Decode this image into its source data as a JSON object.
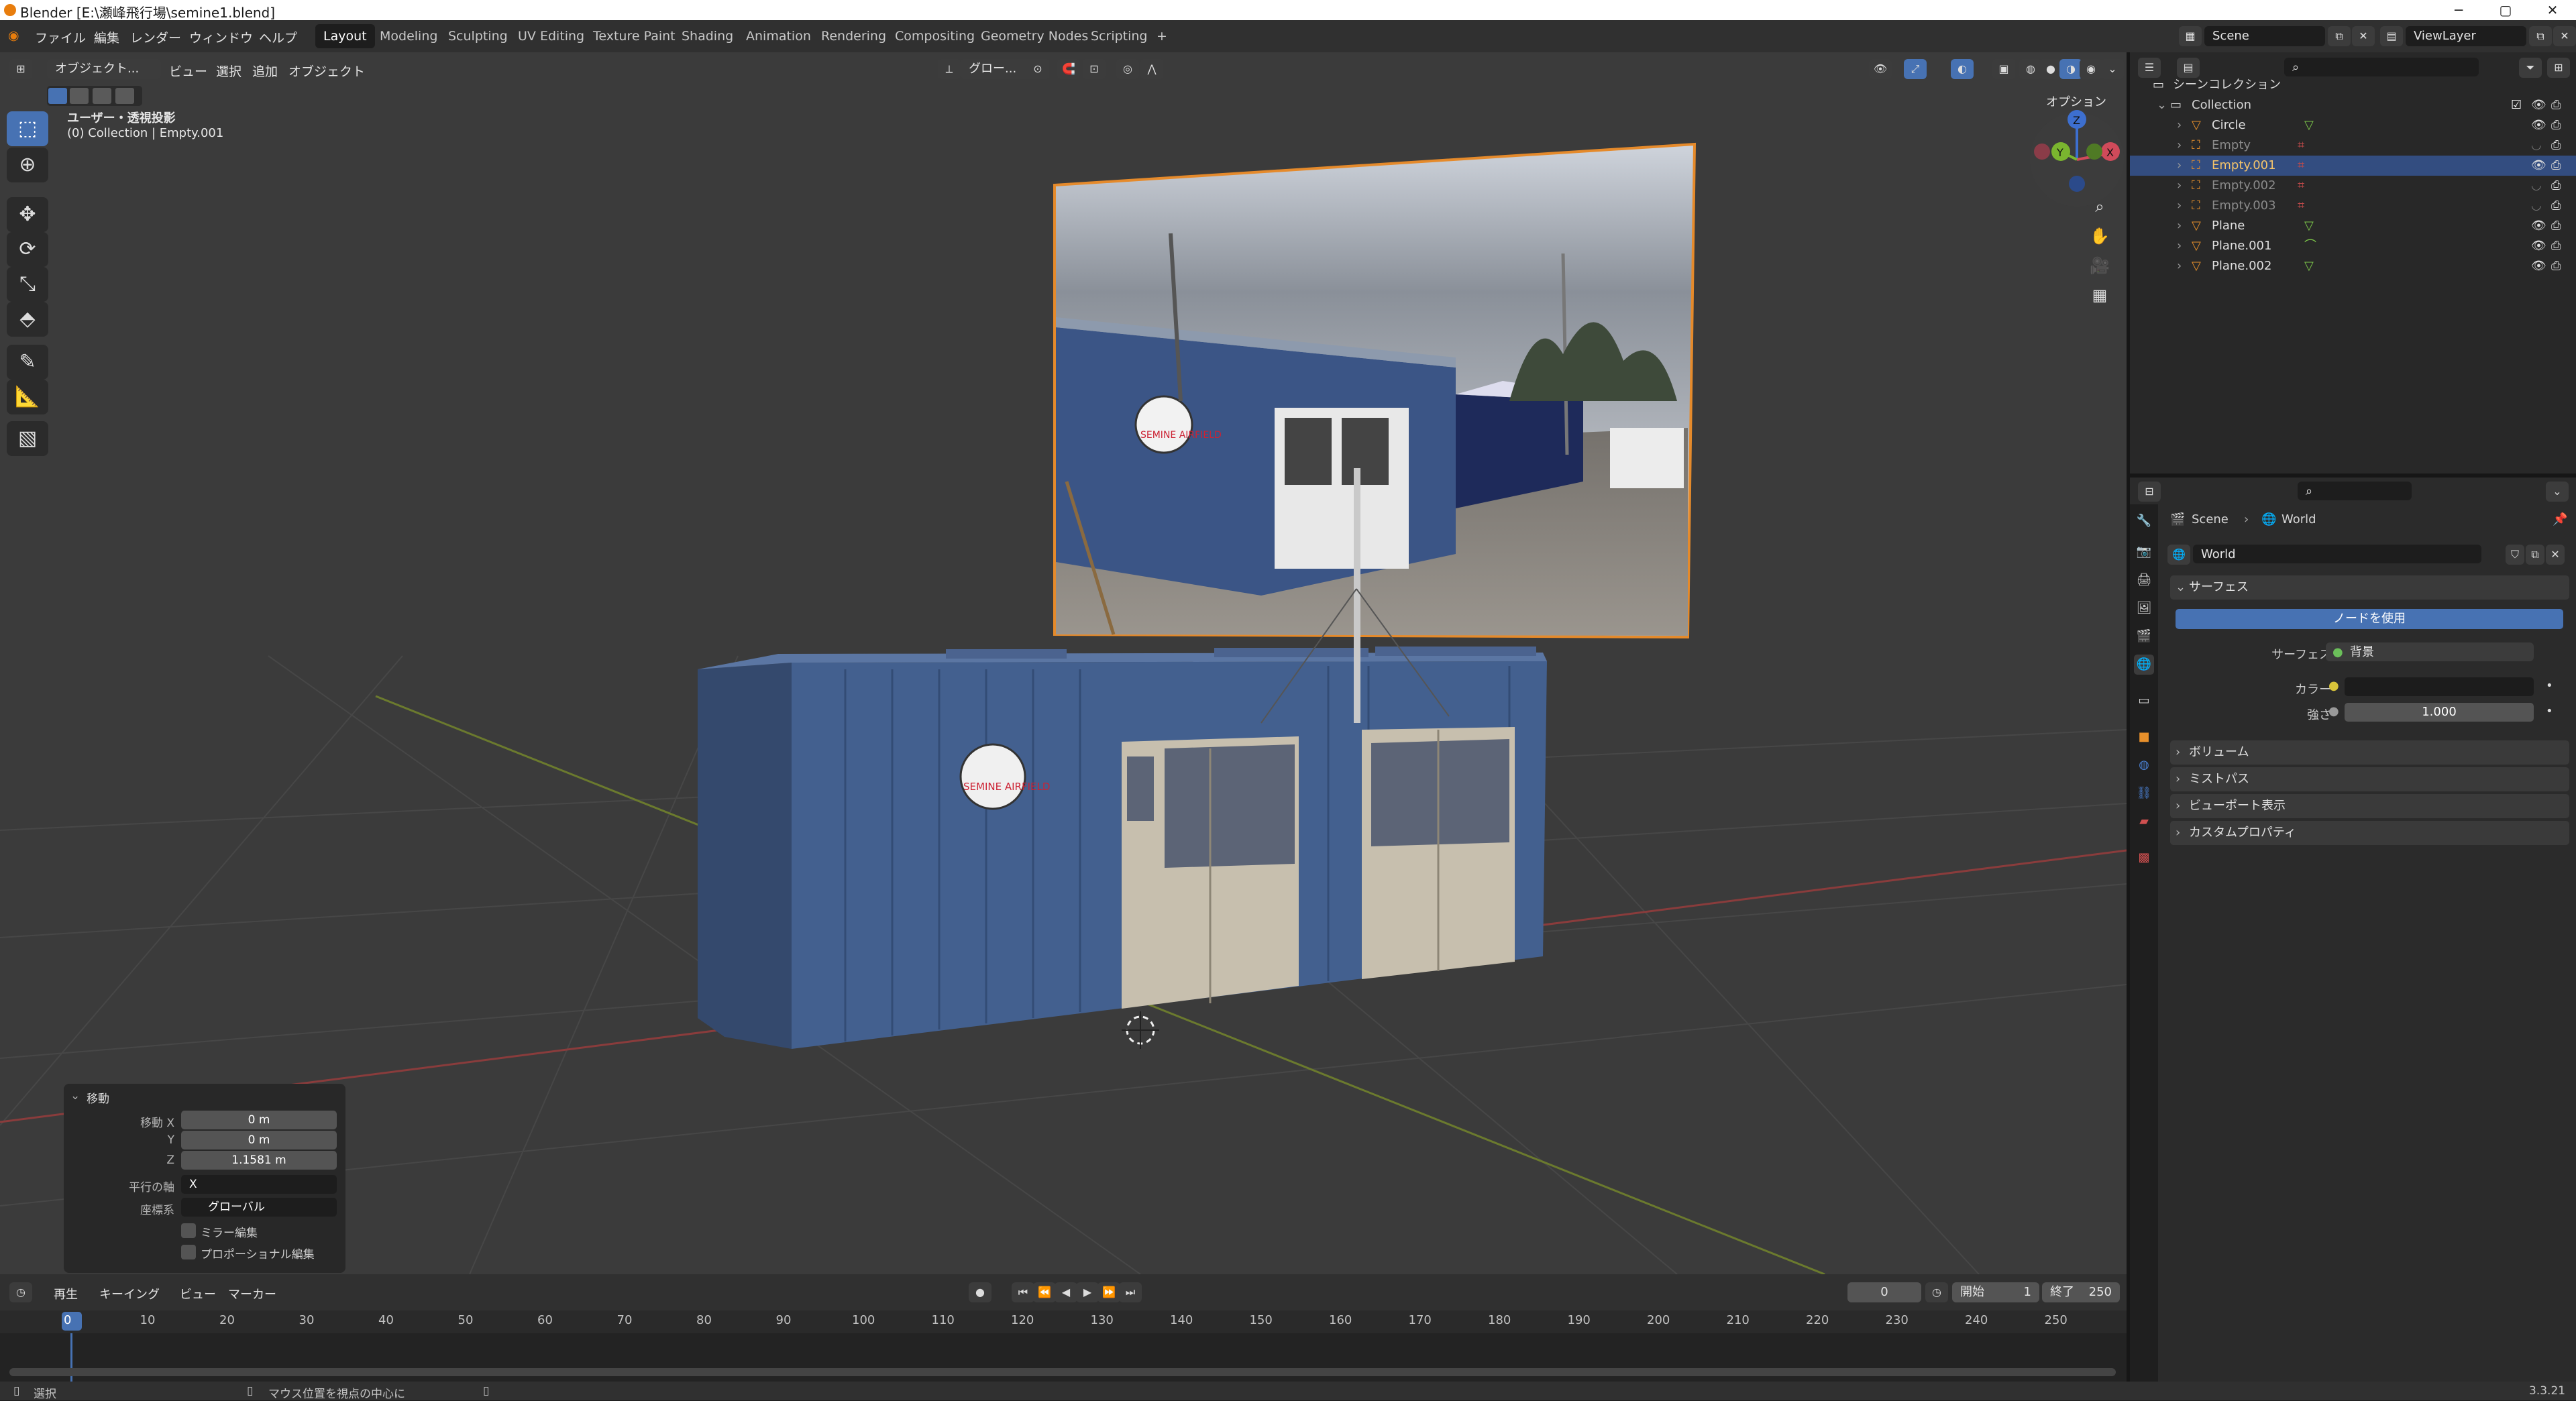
{
  "window": {
    "title": "Blender [E:\\瀬峰飛行場\\semine1.blend]",
    "minimize": "─",
    "maximize": "▢",
    "close": "✕"
  },
  "menus": [
    "ファイル",
    "編集",
    "レンダー",
    "ウィンドウ",
    "ヘルプ"
  ],
  "workspaces": [
    "Layout",
    "Modeling",
    "Sculpting",
    "UV Editing",
    "Texture Paint",
    "Shading",
    "Animation",
    "Rendering",
    "Compositing",
    "Geometry Nodes",
    "Scripting"
  ],
  "add_workspace": "+",
  "scene": {
    "name": "Scene",
    "view_layer": "ViewLayer"
  },
  "viewport": {
    "mode": "オブジェクト...",
    "menus": [
      "ビュー",
      "選択",
      "追加",
      "オブジェクト"
    ],
    "transform_orientation": "グロー...",
    "options": "オプション",
    "info_line1": "ユーザー・透視投影",
    "info_line2": "(0) Collection | Empty.001",
    "tools": [
      "select-box",
      "cursor",
      "move",
      "rotate",
      "scale",
      "transform",
      "annotate",
      "measure",
      "add-cube"
    ],
    "gizmo": {
      "z": "Z",
      "y": "Y",
      "x": "X"
    },
    "sign_text": "SEMINE AIRFIELD"
  },
  "redo_panel": {
    "title": "移動",
    "move_x_label": "移動 X",
    "move_x": "0 m",
    "y_label": "Y",
    "y": "0 m",
    "z_label": "Z",
    "z": "1.1581 m",
    "axis_label": "平行の軸",
    "axis": "X",
    "orient_label": "座標系",
    "orient": "グローバル",
    "mirror": "ミラー編集",
    "proportional": "プロポーショナル編集"
  },
  "timeline": {
    "menus": [
      "再生",
      "キーイング",
      "ビュー",
      "マーカー"
    ],
    "current_frame": "0",
    "start_label": "開始",
    "start": "1",
    "end_label": "終了",
    "end": "250",
    "ticks": [
      "0",
      "10",
      "20",
      "30",
      "40",
      "50",
      "60",
      "70",
      "80",
      "90",
      "100",
      "110",
      "120",
      "130",
      "140",
      "150",
      "160",
      "170",
      "180",
      "190",
      "200",
      "210",
      "220",
      "230",
      "240",
      "250"
    ]
  },
  "status": {
    "select": "選択",
    "center": "マウス位置を視点の中心に",
    "version": "3.3.21"
  },
  "outliner": {
    "root": "シーンコレクション",
    "collection": "Collection",
    "items": [
      {
        "name": "Circle",
        "type": "mesh",
        "selected": false,
        "dim": false
      },
      {
        "name": "Empty",
        "type": "empty",
        "selected": false,
        "dim": true
      },
      {
        "name": "Empty.001",
        "type": "empty",
        "selected": true,
        "dim": false
      },
      {
        "name": "Empty.002",
        "type": "empty",
        "selected": false,
        "dim": true
      },
      {
        "name": "Empty.003",
        "type": "empty",
        "selected": false,
        "dim": true
      },
      {
        "name": "Plane",
        "type": "mesh",
        "selected": false,
        "dim": false
      },
      {
        "name": "Plane.001",
        "type": "curve",
        "selected": false,
        "dim": false
      },
      {
        "name": "Plane.002",
        "type": "mesh",
        "selected": false,
        "dim": false
      }
    ]
  },
  "properties": {
    "breadcrumb_scene": "Scene",
    "breadcrumb_world": "World",
    "world_name": "World",
    "surface_panel": "サーフェス",
    "use_nodes": "ノードを使用",
    "surface_label": "サーフェス",
    "surface_value": "背景",
    "color_label": "カラー",
    "strength_label": "強さ",
    "strength_value": "1.000",
    "panels": [
      "ボリューム",
      "ミストパス",
      "ビューポート表示",
      "カスタムプロパティ"
    ]
  },
  "colors": {
    "accent": "#4772b3",
    "selected_row": "#334d80",
    "outline": "#e58a2b"
  }
}
